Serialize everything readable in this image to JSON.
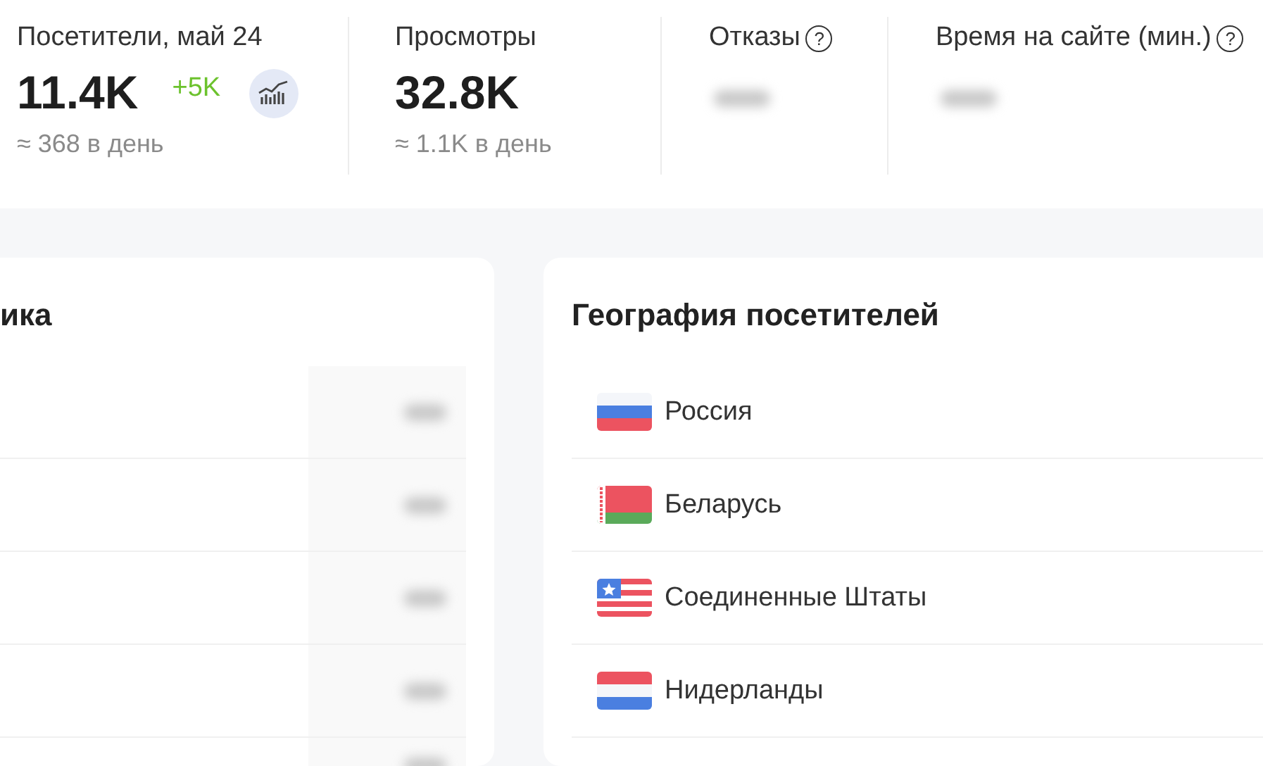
{
  "stats": [
    {
      "label": "Посетители, май 24",
      "value": "11.4K",
      "delta": "+5K",
      "chart_button": true,
      "sub": "≈ 368 в день",
      "hidden": false
    },
    {
      "label": "Просмотры",
      "value": "32.8K",
      "sub": "≈ 1.1K в день",
      "hidden": false
    },
    {
      "label": "Отказы",
      "help": "?",
      "hidden": true
    },
    {
      "label": "Время на сайте (мин.)",
      "help": "?",
      "hidden": true
    }
  ],
  "left_card": {
    "title": "ика",
    "rows": [
      {
        "hidden": true
      },
      {
        "hidden": true
      },
      {
        "hidden": true
      },
      {
        "hidden": true
      },
      {
        "hidden": true
      }
    ]
  },
  "geo_card": {
    "title": "География посетителей",
    "rows": [
      {
        "kind": "ru",
        "name": "Россия"
      },
      {
        "kind": "by",
        "name": "Беларусь"
      },
      {
        "kind": "us",
        "name": "Соединенные Штаты"
      },
      {
        "kind": "nl",
        "name": "Нидерланды"
      }
    ]
  }
}
